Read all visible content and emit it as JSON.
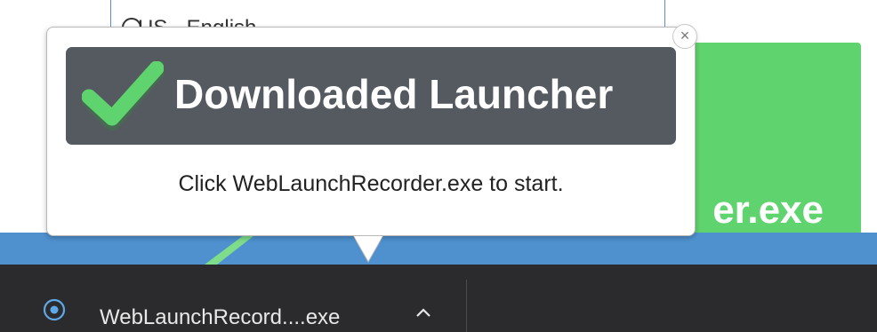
{
  "background": {
    "language_selector": "US - English",
    "green_button_fragment": "er.exe"
  },
  "popup": {
    "title": "Downloaded Launcher",
    "message": "Click WebLaunchRecorder.exe to start.",
    "close_glyph": "×",
    "colors": {
      "banner": "#555a61",
      "check": "#5fd36d"
    }
  },
  "download_bar": {
    "file_name": "WebLaunchRecord....exe",
    "file_icon": "download-progress-icon",
    "options_icon": "chevron-up-icon",
    "colors": {
      "bar": "#2b2b2e",
      "icon": "#5fa8e8"
    }
  }
}
